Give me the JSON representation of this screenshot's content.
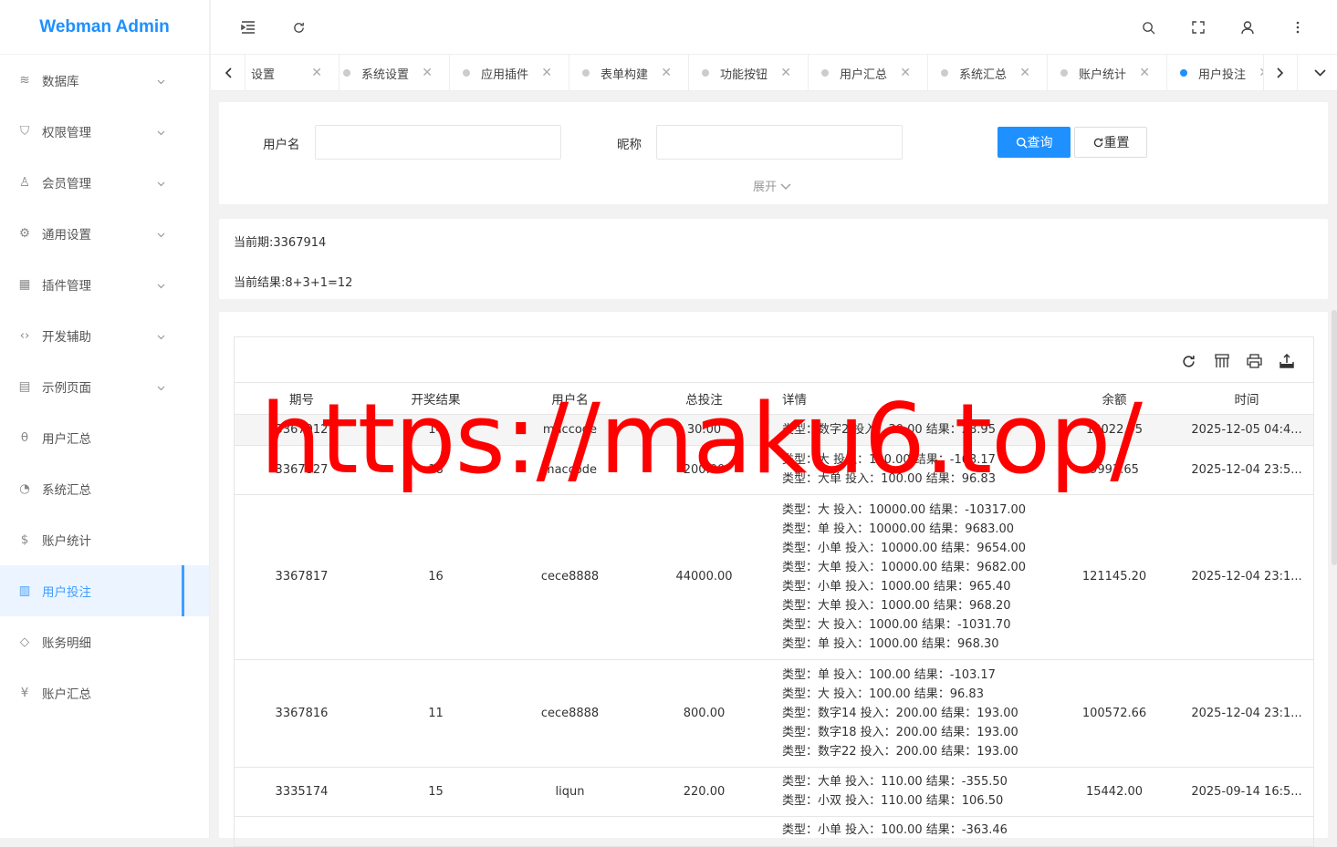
{
  "app": {
    "logo": "Webman Admin"
  },
  "sidebar": {
    "items": [
      {
        "label": "数据库",
        "icon": "layers-icon",
        "glyph": "≋",
        "arrow": true
      },
      {
        "label": "权限管理",
        "icon": "shield-icon",
        "glyph": "⛉",
        "arrow": true
      },
      {
        "label": "会员管理",
        "icon": "user-icon",
        "glyph": "♙",
        "arrow": true
      },
      {
        "label": "通用设置",
        "icon": "gear-icon",
        "glyph": "⚙",
        "arrow": true
      },
      {
        "label": "插件管理",
        "icon": "apps-icon",
        "glyph": "▦",
        "arrow": true
      },
      {
        "label": "开发辅助",
        "icon": "code-icon",
        "glyph": "‹›",
        "arrow": true
      },
      {
        "label": "示例页面",
        "icon": "template-icon",
        "glyph": "▤",
        "arrow": true
      },
      {
        "label": "用户汇总",
        "icon": "theta-icon",
        "glyph": "θ",
        "arrow": false
      },
      {
        "label": "系统汇总",
        "icon": "dashboard-icon",
        "glyph": "◔",
        "arrow": false
      },
      {
        "label": "账户统计",
        "icon": "dollar-icon",
        "glyph": "$",
        "arrow": false
      },
      {
        "label": "用户投注",
        "icon": "list-icon",
        "glyph": "▥",
        "arrow": false,
        "active": true
      },
      {
        "label": "账务明细",
        "icon": "diamond-icon",
        "glyph": "◇",
        "arrow": false
      },
      {
        "label": "账户汇总",
        "icon": "yen-icon",
        "glyph": "¥",
        "arrow": false
      }
    ]
  },
  "tabs": [
    {
      "label": "设置"
    },
    {
      "label": "系统设置"
    },
    {
      "label": "应用插件"
    },
    {
      "label": "表单构建"
    },
    {
      "label": "功能按钮"
    },
    {
      "label": "用户汇总"
    },
    {
      "label": "系统汇总"
    },
    {
      "label": "账户统计"
    },
    {
      "label": "用户投注",
      "active": true
    }
  ],
  "search": {
    "username_label": "用户名",
    "nickname_label": "昵称",
    "query_label": "查询",
    "reset_label": "重置",
    "expand_label": "展开"
  },
  "info": {
    "period": "当前期:3367914",
    "result": "当前结果:8+3+1=12"
  },
  "table": {
    "headers": [
      "期号",
      "开奖结果",
      "用户名",
      "总投注",
      "详情",
      "余额",
      "时间"
    ],
    "rows": [
      {
        "period": "3367912",
        "result": "14",
        "user": "maccode",
        "total": "30.00",
        "details": [
          "类型：数字2 投入：30.00 结果：28.95"
        ],
        "balance": "10022.95",
        "time": "2025-12-05 04:4..."
      },
      {
        "period": "3367827",
        "result": "18",
        "user": "maccode",
        "total": "200.00",
        "details": [
          "类型：大 投入：100.00 结果：-103.17",
          "类型：大单 投入：100.00 结果：96.83"
        ],
        "balance": "9993.65",
        "time": "2025-12-04 23:5..."
      },
      {
        "period": "3367817",
        "result": "16",
        "user": "cece8888",
        "total": "44000.00",
        "details": [
          "类型：大 投入：10000.00 结果：-10317.00",
          "类型：单 投入：10000.00 结果：9683.00",
          "类型：小单 投入：10000.00 结果：9654.00",
          "类型：大单 投入：10000.00 结果：9682.00",
          "类型：小单 投入：1000.00 结果：965.40",
          "类型：大单 投入：1000.00 结果：968.20",
          "类型：大 投入：1000.00 结果：-1031.70",
          "类型：单 投入：1000.00 结果：968.30"
        ],
        "balance": "121145.20",
        "time": "2025-12-04 23:1..."
      },
      {
        "period": "3367816",
        "result": "11",
        "user": "cece8888",
        "total": "800.00",
        "details": [
          "类型：单 投入：100.00 结果：-103.17",
          "类型：大 投入：100.00 结果：96.83",
          "类型：数字14 投入：200.00 结果：193.00",
          "类型：数字18 投入：200.00 结果：193.00",
          "类型：数字22 投入：200.00 结果：193.00"
        ],
        "balance": "100572.66",
        "time": "2025-12-04 23:1..."
      },
      {
        "period": "3335174",
        "result": "15",
        "user": "liqun",
        "total": "220.00",
        "details": [
          "类型：大单 投入：110.00 结果：-355.50",
          "类型：小双 投入：110.00 结果：106.50"
        ],
        "balance": "15442.00",
        "time": "2025-09-14 16:5..."
      },
      {
        "period": "",
        "result": "",
        "user": "",
        "total": "",
        "details": [
          "类型：小单 投入：100.00 结果：-363.46"
        ],
        "balance": "",
        "time": ""
      }
    ]
  },
  "watermark": "https://maku6.top/",
  "colors": {
    "primary": "#1e90ff",
    "active_menu": "#409eff",
    "watermark": "#ff0000"
  }
}
